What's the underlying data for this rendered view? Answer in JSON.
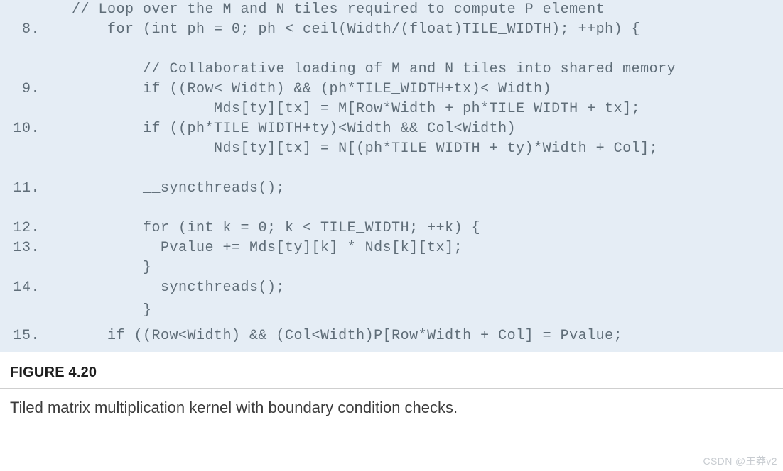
{
  "code": {
    "lines": [
      {
        "num": "",
        "indent": 1,
        "text": "// Loop over the M and N tiles required to compute P element"
      },
      {
        "num": " 8.",
        "indent": 3,
        "text": "for (int ph = 0; ph < ceil(Width/(float)TILE_WIDTH); ++ph) {"
      },
      {
        "num": "",
        "indent": 0,
        "text": ""
      },
      {
        "num": "",
        "indent": 5,
        "text": "// Collaborative loading of M and N tiles into shared memory"
      },
      {
        "num": " 9.",
        "indent": 5,
        "text": "if ((Row< Width) && (ph*TILE_WIDTH+tx)< Width)"
      },
      {
        "num": "",
        "indent": 9,
        "text": "Mds[ty][tx] = M[Row*Width + ph*TILE_WIDTH + tx];"
      },
      {
        "num": "10.",
        "indent": 5,
        "text": "if ((ph*TILE_WIDTH+ty)<Width && Col<Width)"
      },
      {
        "num": "",
        "indent": 9,
        "text": "Nds[ty][tx] = N[(ph*TILE_WIDTH + ty)*Width + Col];"
      },
      {
        "num": "",
        "indent": 0,
        "text": ""
      },
      {
        "num": "11.",
        "indent": 5,
        "text": "__syncthreads();"
      },
      {
        "num": "",
        "indent": 0,
        "text": ""
      },
      {
        "num": "12.",
        "indent": 5,
        "text": "for (int k = 0; k < TILE_WIDTH; ++k) {"
      },
      {
        "num": "13.",
        "indent": 6,
        "text": "Pvalue += Mds[ty][k] * Nds[k][tx];"
      },
      {
        "num": "",
        "indent": 5,
        "text": "}"
      },
      {
        "num": "14.",
        "indent": 5,
        "text": "__syncthreads();"
      },
      {
        "num": "",
        "indent": 5,
        "text": "}",
        "tall": true
      },
      {
        "num": "15.",
        "indent": 3,
        "text": "if ((Row<Width) && (Col<Width)P[Row*Width + Col] = Pvalue;",
        "tall": true
      }
    ]
  },
  "figure": {
    "label": "FIGURE 4.20",
    "caption": "Tiled matrix multiplication kernel with boundary condition checks."
  },
  "watermark": "CSDN @王莽v2"
}
